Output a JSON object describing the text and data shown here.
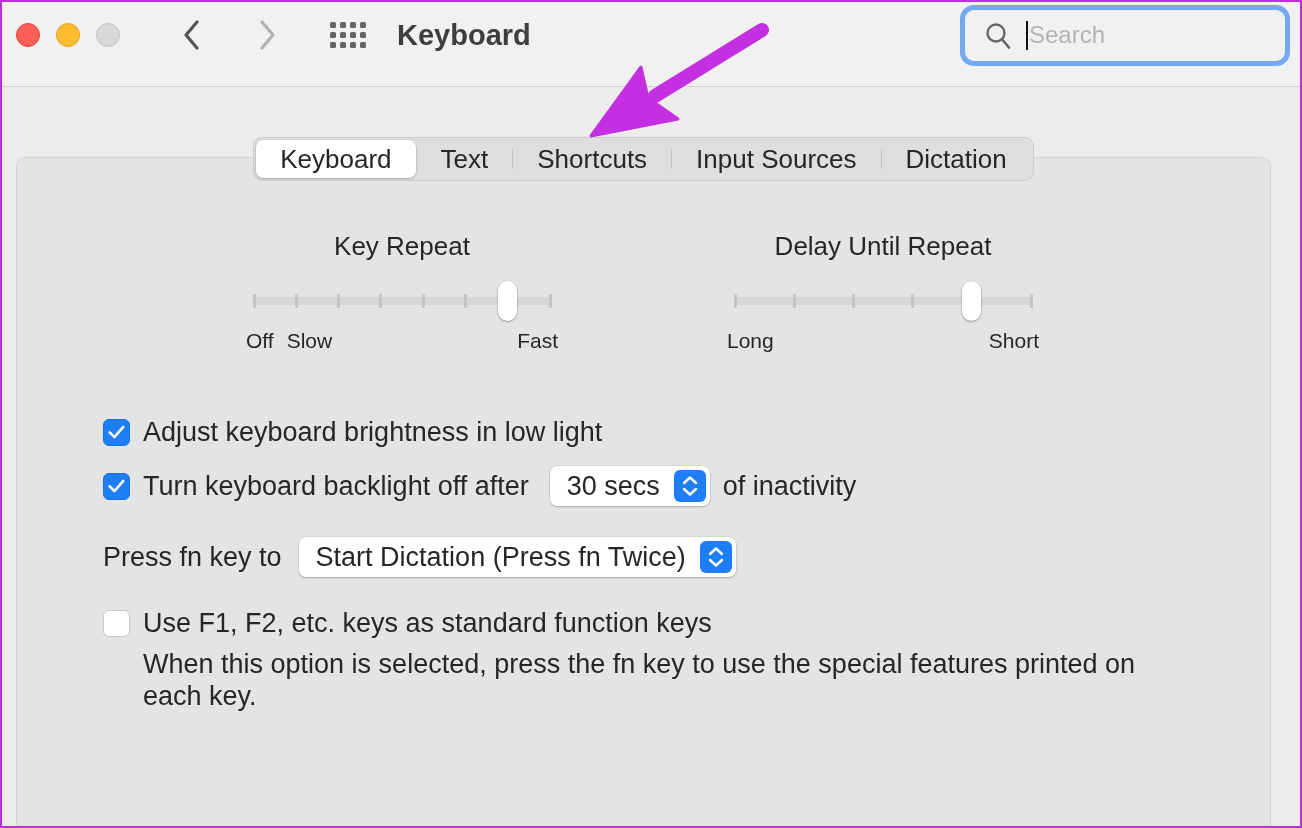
{
  "window": {
    "title": "Keyboard"
  },
  "window_controls": [
    {
      "kind": "close",
      "disabled": false
    },
    {
      "kind": "minimize",
      "disabled": false
    },
    {
      "kind": "zoom",
      "disabled": true
    }
  ],
  "navigation": [
    {
      "kind": "back",
      "disabled": false
    },
    {
      "kind": "forward",
      "disabled": true
    }
  ],
  "search": {
    "placeholder": "Search",
    "focused": true
  },
  "tabs": [
    {
      "label": "Keyboard",
      "selected": true
    },
    {
      "label": "Text",
      "selected": false
    },
    {
      "label": "Shortcuts",
      "selected": false
    },
    {
      "label": "Input Sources",
      "selected": false
    },
    {
      "label": "Dictation",
      "selected": false
    }
  ],
  "sliders": [
    {
      "kind": "rate",
      "title": "Key Repeat",
      "level": 0.857,
      "labels": [
        "Off",
        "Slow",
        "Fast"
      ]
    },
    {
      "kind": "delay",
      "title": "Delay Until Repeat",
      "level": 0.8,
      "labels": [
        "Long",
        "Short"
      ]
    }
  ],
  "options": [
    {
      "kind": "checkbox",
      "label": "Adjust keyboard brightness in low light",
      "checked": true
    },
    {
      "kind": "checkbox",
      "label": "Turn keyboard backlight off after",
      "checked": true,
      "popup": {
        "value": "30 secs"
      },
      "suffix": "of inactivity"
    },
    {
      "kind": "popup",
      "label": "Press fn key to",
      "popup": {
        "value": "Start Dictation (Press fn Twice)"
      }
    },
    {
      "kind": "checkbox",
      "label": "Use F1, F2, etc. keys as standard function keys",
      "checked": false,
      "description": "When this option is selected, press the fn key to use the special features printed on each key."
    }
  ]
}
